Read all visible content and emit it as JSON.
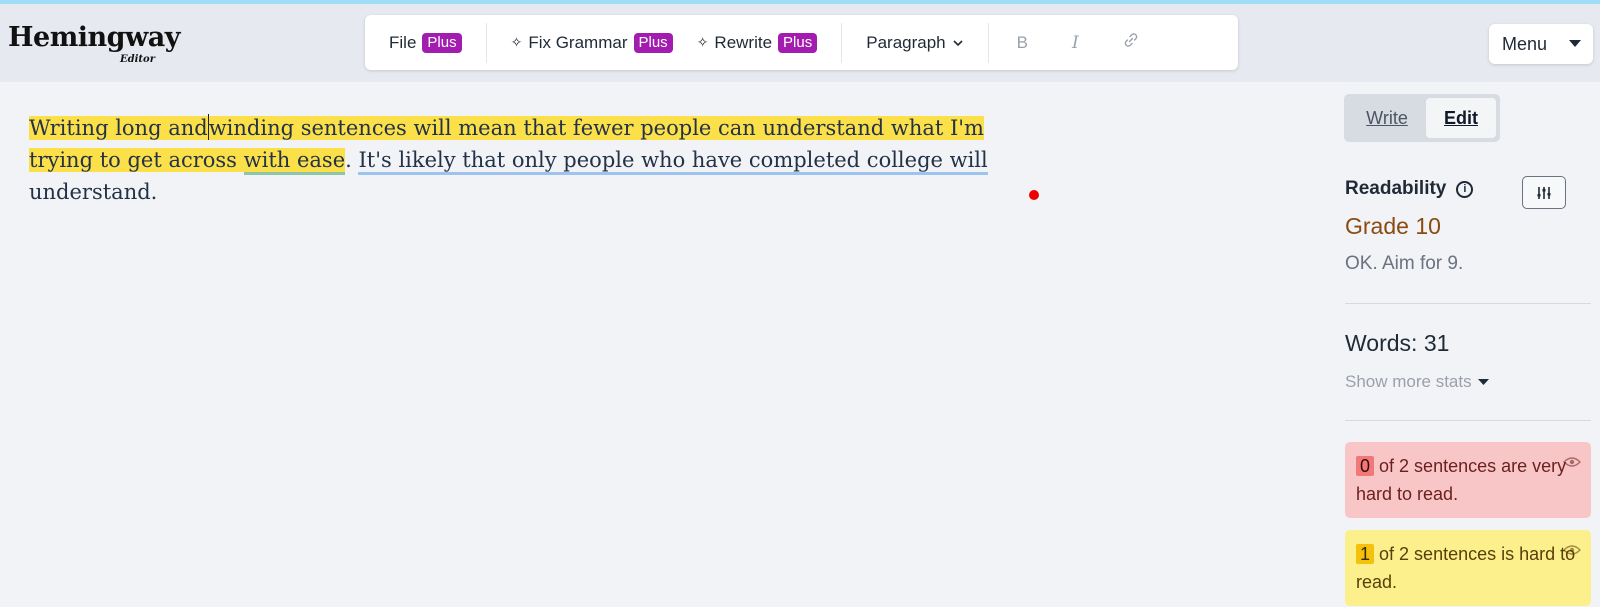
{
  "app": {
    "logo_title": "Hemingway",
    "logo_subtitle": "Editor"
  },
  "toolbar": {
    "file_label": "File",
    "file_badge": "Plus",
    "fix_grammar_label": "Fix Grammar",
    "fix_grammar_badge": "Plus",
    "rewrite_label": "Rewrite",
    "rewrite_badge": "Plus",
    "paragraph_label": "Paragraph",
    "bold_label": "B",
    "italic_label": "I"
  },
  "menu": {
    "label": "Menu"
  },
  "editor": {
    "part1_before_caret": "Writing long and",
    "part1_after_caret": "winding sentences will mean that fewer people can understand what I'm trying to get across ",
    "adverb_phrase": "with ease",
    "period": ". ",
    "passive_sentence": "It's likely that only people who have completed college will",
    "trailing": " understand."
  },
  "mode": {
    "write_label": "Write",
    "edit_label": "Edit",
    "active": "Edit"
  },
  "sidebar": {
    "readability_label": "Readability",
    "grade": "Grade 10",
    "grade_message": "OK. Aim for 9.",
    "words": "Words: 31",
    "show_more_stats": "Show more stats",
    "very_hard_count": "0",
    "very_hard_text": "of 2 sentences are very hard to read.",
    "hard_count": "1",
    "hard_text": "of 2 sentences is hard to read."
  },
  "colors": {
    "very_hard_highlight": "#fbe04a",
    "plus_badge": "#a21caf",
    "grade_color": "#8a4b12",
    "card_red": "#f8c6c6",
    "card_yellow": "#fbf08b"
  }
}
